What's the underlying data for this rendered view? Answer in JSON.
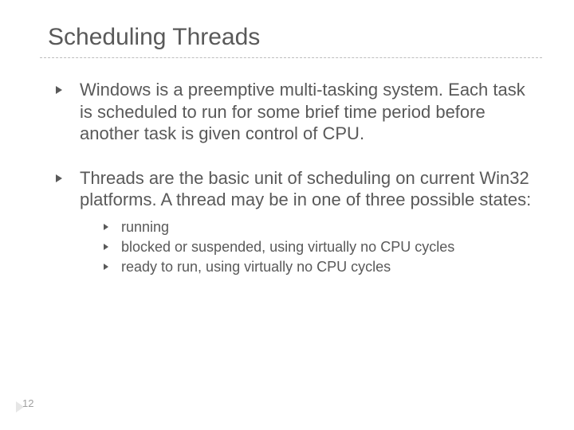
{
  "slide": {
    "title": "Scheduling Threads",
    "bullets": [
      {
        "text": "Windows is a preemptive multi-tasking system. Each task is scheduled to run for some brief time period before another task is given control of CPU."
      },
      {
        "text": "Threads are the basic unit of scheduling on current Win32 platforms.   A thread may be in one of three possible states:",
        "sub": [
          "running",
          "blocked or suspended, using virtually no CPU cycles",
          "ready to run, using virtually no CPU cycles"
        ]
      }
    ],
    "page_number": "12"
  }
}
